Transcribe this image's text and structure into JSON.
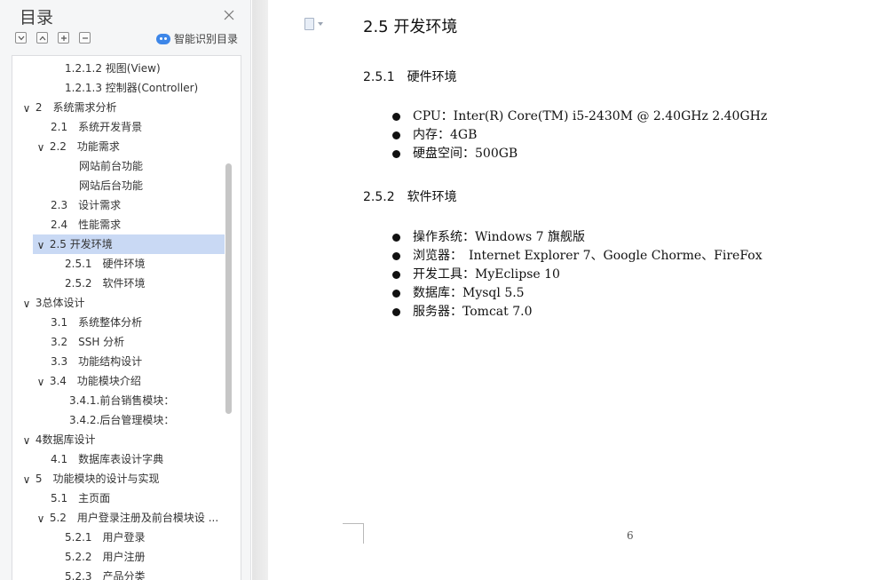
{
  "toc": {
    "title": "目录",
    "smart_label": "智能识别目录",
    "items": [
      {
        "label": "1.2.1.2 视图(View)",
        "chevron": ""
      },
      {
        "label": "1.2.1.3 控制器(Controller)",
        "chevron": ""
      },
      {
        "label": "2　系统需求分析",
        "chevron": "∨"
      },
      {
        "label": "2.1　系统开发背景",
        "chevron": ""
      },
      {
        "label": "2.2　功能需求",
        "chevron": "∨"
      },
      {
        "label": "网站前台功能",
        "chevron": ""
      },
      {
        "label": "网站后台功能",
        "chevron": ""
      },
      {
        "label": "2.3　设计需求",
        "chevron": ""
      },
      {
        "label": "2.4　性能需求",
        "chevron": ""
      },
      {
        "label": "2.5  开发环境",
        "chevron": "∨"
      },
      {
        "label": "2.5.1　硬件环境",
        "chevron": ""
      },
      {
        "label": "2.5.2　软件环境",
        "chevron": ""
      },
      {
        "label": "3总体设计",
        "chevron": "∨"
      },
      {
        "label": "3.1　系统整体分析",
        "chevron": ""
      },
      {
        "label": "3.2　SSH 分析",
        "chevron": ""
      },
      {
        "label": "3.3　功能结构设计",
        "chevron": ""
      },
      {
        "label": "3.4　功能模块介绍",
        "chevron": "∨"
      },
      {
        "label": "3.4.1.前台销售模块：",
        "chevron": ""
      },
      {
        "label": "3.4.2.后台管理模块：",
        "chevron": ""
      },
      {
        "label": "4数据库设计",
        "chevron": "∨"
      },
      {
        "label": "4.1　数据库表设计字典",
        "chevron": ""
      },
      {
        "label": "5　功能模块的设计与实现",
        "chevron": "∨"
      },
      {
        "label": "5.1　主页面",
        "chevron": ""
      },
      {
        "label": "5.2　用户登录注册及前台模块设 ...",
        "chevron": "∨"
      },
      {
        "label": "5.2.1　用户登录",
        "chevron": ""
      },
      {
        "label": "5.2.2　用户注册",
        "chevron": ""
      },
      {
        "label": "5.2.3　产品分类",
        "chevron": ""
      }
    ]
  },
  "document": {
    "heading": "2.5  开发环境",
    "hardware": {
      "heading": "2.5.1　硬件环境",
      "items": [
        "CPU：Inter(R) Core(TM) i5-2430M @ 2.40GHz 2.40GHz",
        "内存：4GB",
        "硬盘空间：500GB"
      ]
    },
    "software": {
      "heading": "2.5.2　软件环境",
      "items": [
        "操作系统：Windows 7 旗舰版",
        "浏览器：　Internet Explorer 7、Google Chorme、FireFox",
        "开发工具：MyEclipse 10",
        "数据库：Mysql 5.5",
        "服务器：Tomcat 7.0"
      ]
    },
    "page_number": "6"
  }
}
